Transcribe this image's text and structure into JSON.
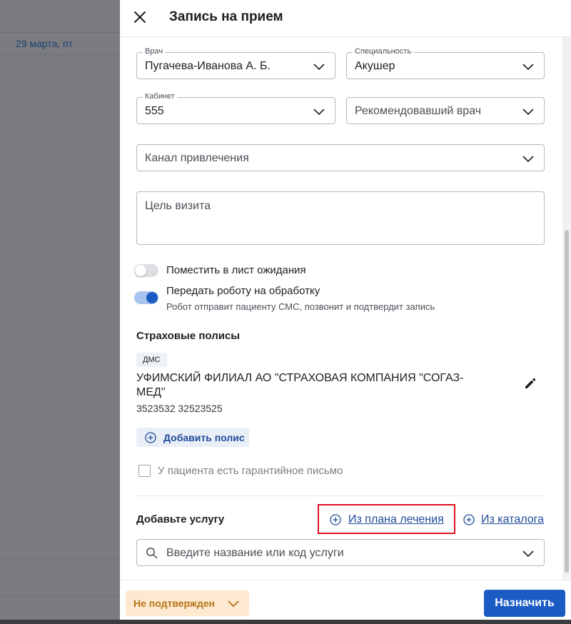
{
  "background": {
    "date_label": "29 марта, пт"
  },
  "drawer": {
    "title": "Запись на прием",
    "doctor": {
      "label": "Врач",
      "value": "Пугачева-Иванова А. Б."
    },
    "specialty": {
      "label": "Специальность",
      "value": "Акушер"
    },
    "cabinet": {
      "label": "Кабинет",
      "value": "555"
    },
    "referring_doctor": {
      "placeholder": "Рекомендовавший врач"
    },
    "channel": {
      "placeholder": "Канал привлечения"
    },
    "visit_goal": {
      "placeholder": "Цель визита"
    },
    "waitlist_toggle": {
      "label": "Поместить в лист ожидания",
      "on": false
    },
    "robot_toggle": {
      "label": "Передать роботу на обработку",
      "hint": "Робот отправит пациенту СМС, позвонит и подтвердит запись",
      "on": true
    },
    "insurance": {
      "heading": "Страховые полисы",
      "policy": {
        "tag": "ДМС",
        "company_line1": "УФИМСКИЙ ФИЛИАЛ АО \"СТРАХОВАЯ КОМПАНИЯ \"СОГАЗ-",
        "company_line2": "МЕД\"",
        "number": "3523532 32523525"
      },
      "add_policy_label": "Добавить полис",
      "guarantee_letter_label": "У пациента есть гарантийное письмо"
    },
    "services": {
      "heading": "Добавьте услугу",
      "from_plan_label": "Из плана лечения",
      "from_catalog_label": "Из каталога",
      "search_placeholder": "Введите название или код услуги"
    },
    "footer": {
      "status_label": "Не подтвержден",
      "assign_label": "Назначить"
    }
  },
  "colors": {
    "accent": "#1a5bc4",
    "link": "#1f4c9a",
    "status_bg": "#fde9cf",
    "status_text": "#b8741a",
    "highlight": "#e0141e"
  }
}
